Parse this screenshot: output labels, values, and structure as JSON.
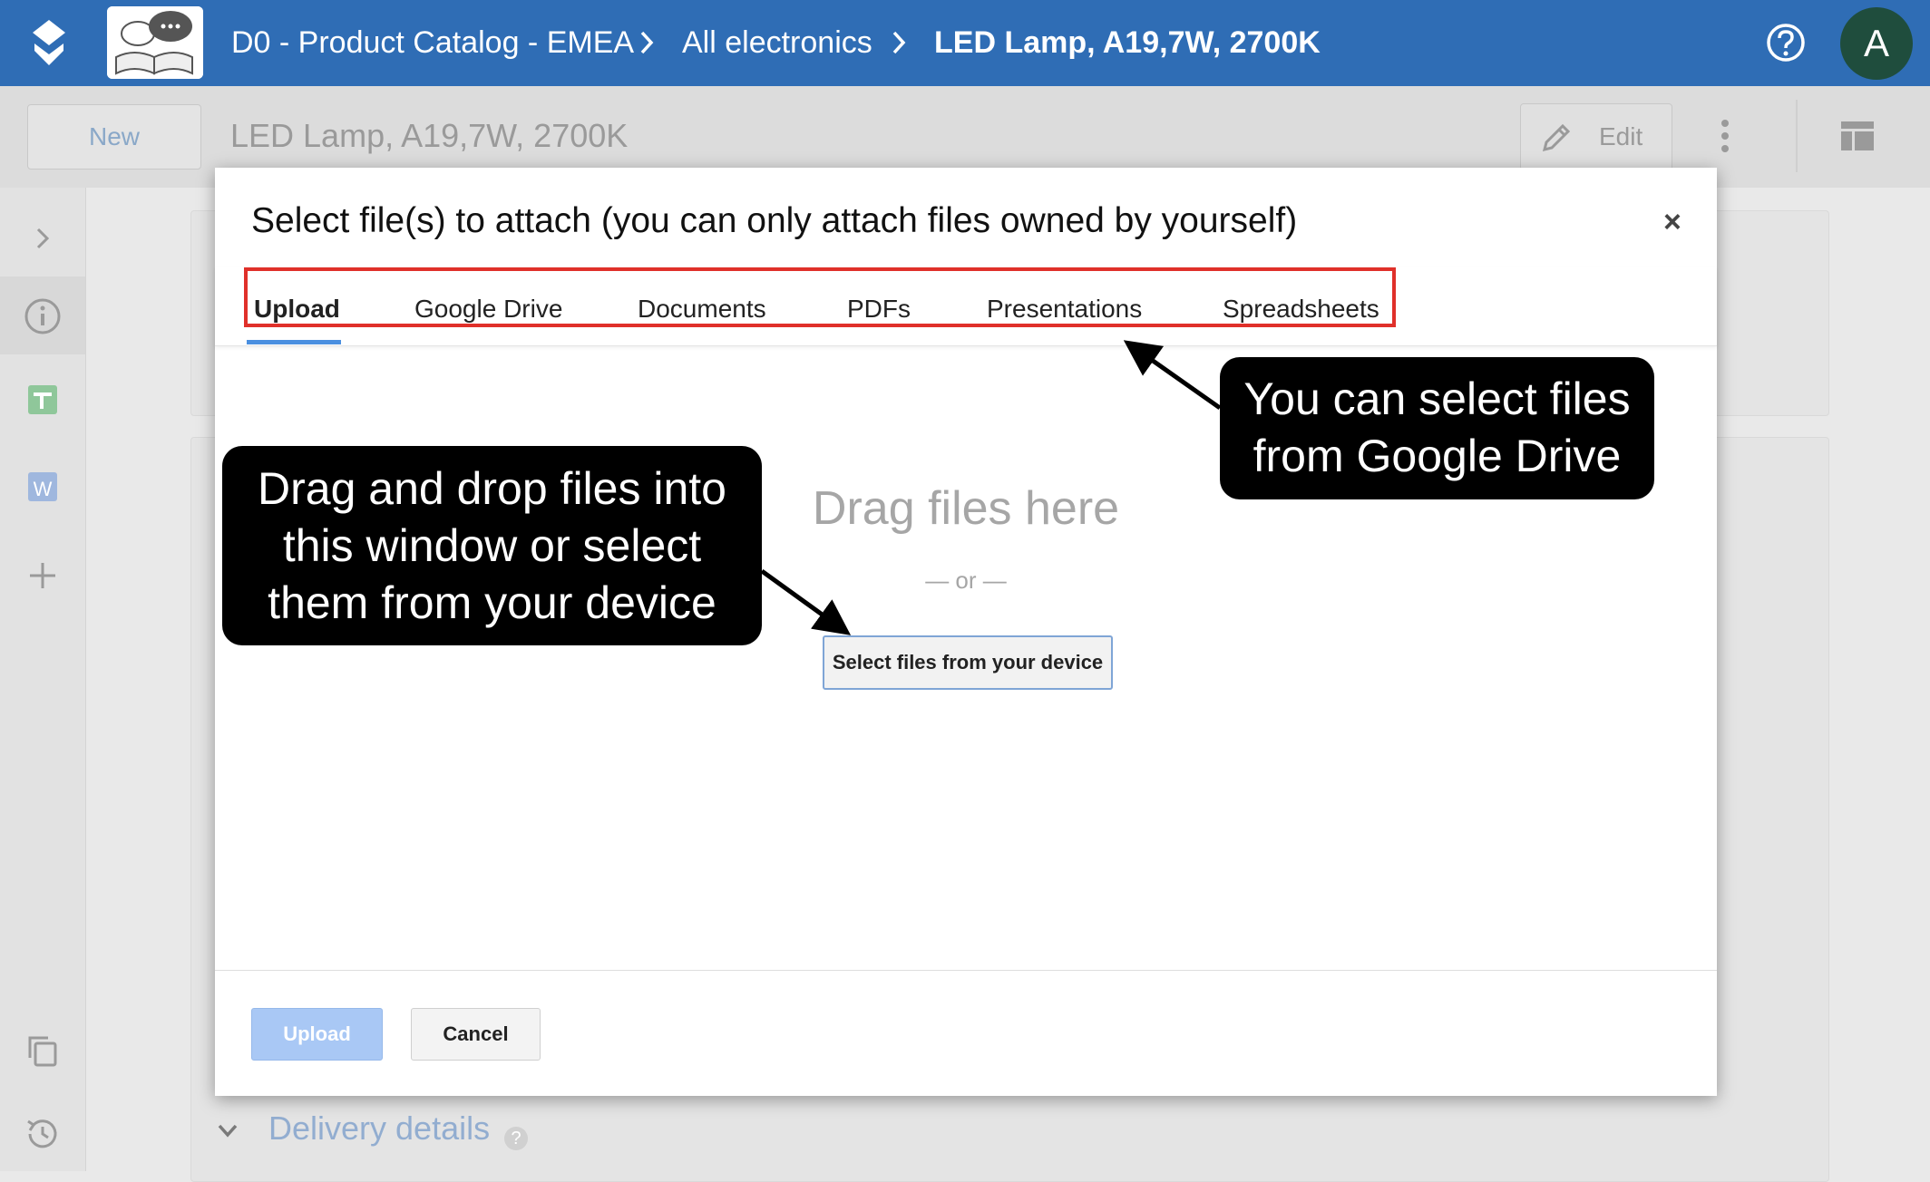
{
  "topbar": {
    "breadcrumbs": [
      "D0 - Product Catalog - EMEA",
      "All electronics",
      "LED Lamp, A19,7W, 2700K"
    ],
    "avatar_letter": "A"
  },
  "record": {
    "new_label": "New",
    "title": "LED Lamp, A19,7W, 2700K",
    "edit_label": "Edit"
  },
  "background": {
    "section_label": "Delivery details",
    "help_mark": "?"
  },
  "dialog": {
    "title": "Select file(s) to attach (you can only attach files owned by yourself)",
    "close": "×",
    "tabs": [
      "Upload",
      "Google Drive",
      "Documents",
      "PDFs",
      "Presentations",
      "Spreadsheets"
    ],
    "active_tab": "Upload",
    "drag_text": "Drag files here",
    "or_text": "— or —",
    "select_button": "Select files from your device",
    "upload_button": "Upload",
    "cancel_button": "Cancel"
  },
  "annotations": {
    "drive_callout": [
      "You can select files",
      "from Google Drive"
    ],
    "drag_callout": [
      "Drag and drop files into",
      "this window or select",
      "them from your device"
    ]
  },
  "colors": {
    "topbar": "#2f6db5",
    "highlight": "#e0302a",
    "tab_underline": "#4a8fe0"
  }
}
